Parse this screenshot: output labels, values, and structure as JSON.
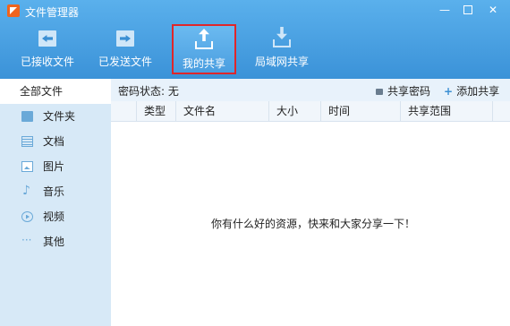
{
  "window": {
    "title": "文件管理器",
    "controls": {
      "minimize": "—",
      "close": "✕"
    }
  },
  "toolbar": {
    "items": [
      {
        "label": "已接收文件",
        "icon": "received-files-icon",
        "active": false
      },
      {
        "label": "已发送文件",
        "icon": "sent-files-icon",
        "active": false
      },
      {
        "label": "我的共享",
        "icon": "my-share-upload-icon",
        "active": true
      },
      {
        "label": "局域网共享",
        "icon": "lan-share-download-icon",
        "active": false
      }
    ]
  },
  "sidebar": {
    "items": [
      {
        "label": "全部文件",
        "icon": "",
        "selected": true
      },
      {
        "label": "文件夹",
        "icon": "folder-icon"
      },
      {
        "label": "文档",
        "icon": "document-icon"
      },
      {
        "label": "图片",
        "icon": "picture-icon"
      },
      {
        "label": "音乐",
        "icon": "music-icon",
        "glyph": "♪"
      },
      {
        "label": "视频",
        "icon": "video-icon"
      },
      {
        "label": "其他",
        "icon": "more-icon",
        "glyph": "···"
      }
    ]
  },
  "main": {
    "password_status": "密码状态: 无",
    "share_password_label": "共享密码",
    "add_share_label": "添加共享",
    "add_share_glyph": "+",
    "columns": [
      "类型",
      "文件名",
      "大小",
      "时间",
      "共享范围"
    ],
    "empty_message": "你有什么好的资源，快来和大家分享一下！"
  },
  "colors": {
    "toolbar_top": "#5ab0ec",
    "toolbar_bottom": "#3b92d8",
    "sidebar_bg": "#d7e9f7",
    "active_border": "#e0262a",
    "accent": "#3b8fd3"
  }
}
